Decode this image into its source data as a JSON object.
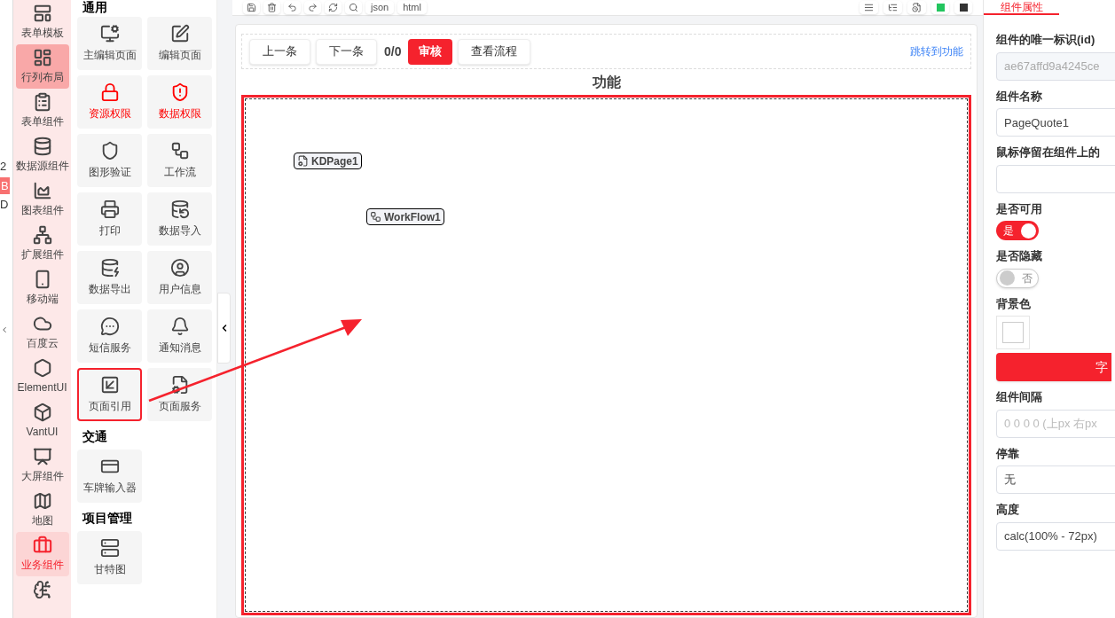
{
  "left_edge": {
    "fragments": [
      "2",
      "B",
      "D"
    ]
  },
  "categories": [
    {
      "label": "表单模板",
      "selected": false,
      "current": false
    },
    {
      "label": "行列布局",
      "selected": true,
      "current": false
    },
    {
      "label": "表单组件",
      "selected": false,
      "current": false
    },
    {
      "label": "数据源组件",
      "selected": false,
      "current": false
    },
    {
      "label": "图表组件",
      "selected": false,
      "current": false
    },
    {
      "label": "扩展组件",
      "selected": false,
      "current": false
    },
    {
      "label": "移动端",
      "selected": false,
      "current": false
    },
    {
      "label": "百度云",
      "selected": false,
      "current": false
    },
    {
      "label": "ElementUI",
      "selected": false,
      "current": false
    },
    {
      "label": "VantUI",
      "selected": false,
      "current": false
    },
    {
      "label": "大屏组件",
      "selected": false,
      "current": false
    },
    {
      "label": "地图",
      "selected": false,
      "current": false
    },
    {
      "label": "业务组件",
      "selected": false,
      "current": true
    }
  ],
  "sections": [
    {
      "title": "通用",
      "items": [
        {
          "label": "主编辑页面",
          "danger": false,
          "highlighted": false
        },
        {
          "label": "编辑页面",
          "danger": false,
          "highlighted": false
        },
        {
          "label": "资源权限",
          "danger": true,
          "highlighted": false
        },
        {
          "label": "数据权限",
          "danger": true,
          "highlighted": false
        },
        {
          "label": "图形验证",
          "danger": false,
          "highlighted": false
        },
        {
          "label": "工作流",
          "danger": false,
          "highlighted": false
        },
        {
          "label": "打印",
          "danger": false,
          "highlighted": false
        },
        {
          "label": "数据导入",
          "danger": false,
          "highlighted": false
        },
        {
          "label": "数据导出",
          "danger": false,
          "highlighted": false
        },
        {
          "label": "用户信息",
          "danger": false,
          "highlighted": false
        },
        {
          "label": "短信服务",
          "danger": false,
          "highlighted": false
        },
        {
          "label": "通知消息",
          "danger": false,
          "highlighted": false
        },
        {
          "label": "页面引用",
          "danger": false,
          "highlighted": true
        },
        {
          "label": "页面服务",
          "danger": false,
          "highlighted": false
        }
      ]
    },
    {
      "title": "交通",
      "items": [
        {
          "label": "车牌输入器",
          "danger": false,
          "highlighted": false
        }
      ]
    },
    {
      "title": "项目管理",
      "items": [
        {
          "label": "甘特图",
          "danger": false,
          "highlighted": false
        }
      ]
    }
  ],
  "toolbar": {
    "left": [
      {
        "kind": "icon"
      },
      {
        "kind": "icon"
      },
      {
        "kind": "icon"
      },
      {
        "kind": "icon"
      },
      {
        "kind": "icon"
      },
      {
        "kind": "icon"
      },
      {
        "kind": "text",
        "label": "json"
      },
      {
        "kind": "text",
        "label": "html"
      }
    ],
    "right": [
      {
        "kind": "icon"
      },
      {
        "kind": "icon"
      },
      {
        "kind": "icon"
      },
      {
        "kind": "swatch",
        "color": "#22c55e"
      },
      {
        "kind": "swatch",
        "color": "#333333"
      }
    ]
  },
  "canvas": {
    "actions": [
      {
        "kind": "button",
        "label": "上一条"
      },
      {
        "kind": "button",
        "label": "下一条"
      },
      {
        "kind": "counter",
        "label": "0/0"
      },
      {
        "kind": "primary",
        "label": "审核"
      },
      {
        "kind": "button",
        "label": "查看流程"
      }
    ],
    "link": "跳转到功能",
    "title": "功能",
    "nodes": [
      {
        "label": "KDPage1"
      },
      {
        "label": "WorkFlow1"
      }
    ]
  },
  "properties": {
    "tab": "组件属性",
    "fields": [
      {
        "kind": "input",
        "label": "组件的唯一标识(id)",
        "value": "ae67affd9a4245ce",
        "disabled": true
      },
      {
        "kind": "input",
        "label": "组件名称",
        "value": "PageQuote1"
      },
      {
        "kind": "input",
        "label": "鼠标停留在组件上的"
      },
      {
        "kind": "switch",
        "label": "是否可用",
        "on": true,
        "text": "是"
      },
      {
        "kind": "switch",
        "label": "是否隐藏",
        "on": false,
        "text": "否"
      },
      {
        "kind": "color",
        "label": "背景色"
      },
      {
        "kind": "button",
        "text": "字"
      },
      {
        "kind": "input",
        "label": "组件间隔",
        "placeholder": "0 0 0 0 (上px 右px"
      },
      {
        "kind": "input",
        "label": "停靠",
        "value": "无"
      },
      {
        "kind": "input",
        "label": "高度",
        "value": "calc(100% - 72px)"
      }
    ]
  }
}
